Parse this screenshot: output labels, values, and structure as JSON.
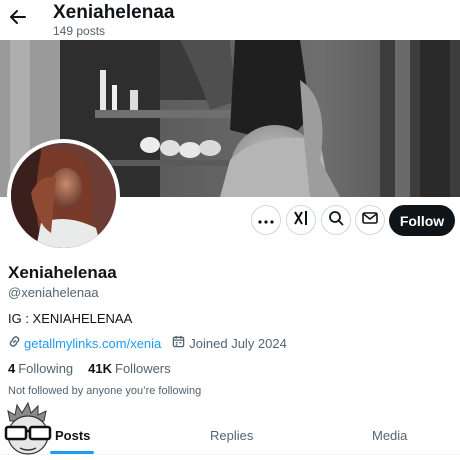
{
  "header": {
    "title": "Xeniahelenaa",
    "posts_count": "149 posts"
  },
  "profile": {
    "display_name": "Xeniahelenaa",
    "handle": "@xeniahelenaa",
    "bio": "IG : XENIAHELENAA",
    "link_text": "getallmylinks.com/xenia",
    "joined": "Joined July 2024",
    "following_count": "4",
    "following_label": "Following",
    "followers_count": "41K",
    "followers_label": "Followers",
    "not_followed_note": "Not followed by anyone you’re following"
  },
  "actions": {
    "grok_label": "X/",
    "follow_label": "Follow"
  },
  "tabs": [
    {
      "label": "Posts",
      "active": true
    },
    {
      "label": "Replies",
      "active": false
    },
    {
      "label": "Media",
      "active": false
    }
  ],
  "icons": {
    "back": "back-arrow-icon",
    "more": "more-icon",
    "grok": "grok-icon",
    "search": "search-icon",
    "message": "mail-icon",
    "link": "link-icon",
    "calendar": "calendar-icon"
  },
  "colors": {
    "accent": "#1d9bf0",
    "text_primary": "#0f1419",
    "text_secondary": "#536471",
    "follow_bg": "#0f1419"
  }
}
